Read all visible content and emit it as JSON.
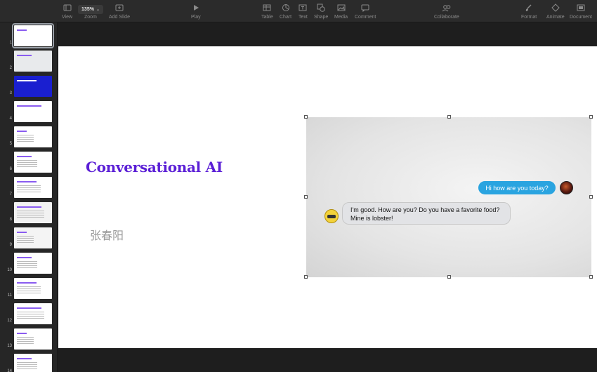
{
  "toolbar": {
    "view": "View",
    "zoom_value": "135%",
    "zoom": "Zoom",
    "add_slide": "Add Slide",
    "play": "Play",
    "table": "Table",
    "chart": "Chart",
    "text": "Text",
    "shape": "Shape",
    "media": "Media",
    "comment": "Comment",
    "collaborate": "Collaborate",
    "format": "Format",
    "animate": "Animate",
    "document": "Document"
  },
  "sidebar": {
    "slides": [
      "1",
      "2",
      "3",
      "4",
      "5",
      "6",
      "7",
      "8",
      "9",
      "10",
      "11",
      "12",
      "13",
      "14"
    ],
    "selected": "1"
  },
  "slide": {
    "title": "Conversational AI",
    "author": "张春阳",
    "chat": {
      "user_message": "Hi how are you today?",
      "bot_message_line1": "I'm good. How are you? Do you have a favorite food?",
      "bot_message_line2": "Mine is lobster!"
    }
  },
  "colors": {
    "title": "#5b1fd6",
    "user_bubble": "#2aa4e0",
    "author": "#9a9a9a"
  }
}
